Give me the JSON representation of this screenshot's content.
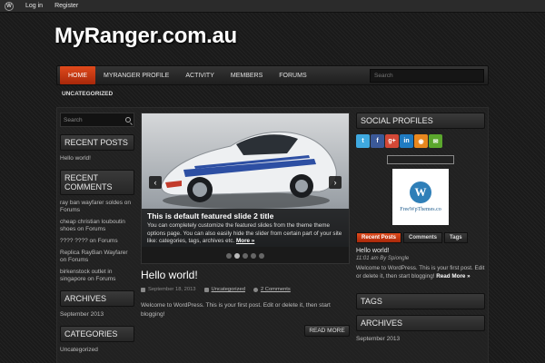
{
  "adminbar": {
    "login": "Log in",
    "register": "Register"
  },
  "site": {
    "title": "MyRanger.com.au"
  },
  "nav": {
    "items": [
      "HOME",
      "MYRANGER PROFILE",
      "ACTIVITY",
      "MEMBERS",
      "FORUMS"
    ],
    "search_placeholder": "Search",
    "sub": "UNCATEGORIZED"
  },
  "left_sidebar": {
    "search_placeholder": "Search",
    "recent_posts_title": "RECENT POSTS",
    "recent_posts": [
      "Hello world!"
    ],
    "recent_comments_title": "RECENT COMMENTS",
    "recent_comments": [
      "ray ban wayfarer soldes on Forums",
      "cheap christian louboutin shoes on Forums",
      "???? ???? on Forums",
      "Replica RayBan Wayfarer on Forums",
      "birkenstock outlet in singapore on Forums"
    ],
    "archives_title": "ARCHIVES",
    "archives": [
      "September 2013"
    ],
    "categories_title": "CATEGORIES",
    "categories": [
      "Uncategorized"
    ]
  },
  "slider": {
    "title": "This is default featured slide 2 title",
    "text": "You can completely customize the featured slides from the theme theme options page. You can also easily hide the slider from certain part of your site like: categories, tags, archives etc.",
    "more": "More »",
    "prev": "‹",
    "next": "›"
  },
  "post": {
    "title": "Hello world!",
    "date": "September 18, 2013",
    "category": "Uncategorized",
    "comments": "2 Comments",
    "excerpt": "Welcome to WordPress. This is your first post. Edit or delete it, then start blogging!",
    "read_more": "READ MORE"
  },
  "right_sidebar": {
    "social_title": "SOCIAL PROFILES",
    "social_icons": [
      {
        "name": "twitter-icon",
        "glyph": "t",
        "color": "#3fa9e0"
      },
      {
        "name": "facebook-icon",
        "glyph": "f",
        "color": "#3b5998"
      },
      {
        "name": "googleplus-icon",
        "glyph": "g+",
        "color": "#d34836"
      },
      {
        "name": "linkedin-icon",
        "glyph": "in",
        "color": "#1f7bc1"
      },
      {
        "name": "rss-icon",
        "glyph": "◉",
        "color": "#e8871e"
      },
      {
        "name": "email-icon",
        "glyph": "✉",
        "color": "#5ba72d"
      }
    ],
    "badge_text": "FreeWpThemes.co",
    "tabs": [
      "Recent Posts",
      "Comments",
      "Tags"
    ],
    "tab_post_title": "Hello world!",
    "tab_post_meta": "11:01 am By Spiongle",
    "tab_post_text": "Welcome to WordPress. This is your first post. Edit or delete it, then start blogging!",
    "tab_read_more": "Read More »",
    "tags_title": "TAGS",
    "archives_title": "ARCHIVES",
    "archives": [
      "September 2013"
    ]
  }
}
